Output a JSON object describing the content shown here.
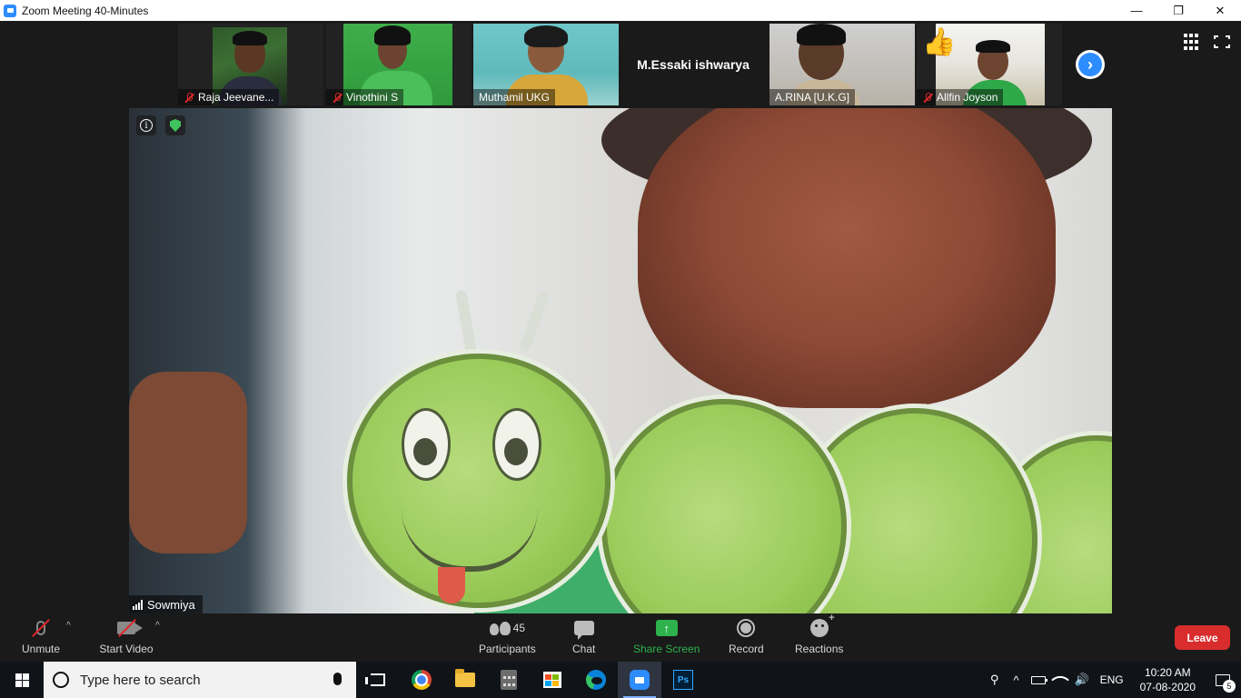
{
  "window": {
    "title": "Zoom Meeting 40-Minutes",
    "controls": [
      "—",
      "❐",
      "✕"
    ]
  },
  "participants_strip": [
    {
      "name": "Raja Jeevane...",
      "muted": true
    },
    {
      "name": "Vinothini S",
      "muted": true
    },
    {
      "name": "Muthamil UKG",
      "muted": false
    },
    {
      "name": "M.Essaki ishwarya",
      "muted": false,
      "video_off": true
    },
    {
      "name": "A.RINA  [U.K.G]",
      "muted": false
    },
    {
      "name": "Allfin Joyson",
      "muted": true,
      "reaction": "👍"
    }
  ],
  "next_page_icon": "chevron-right-icon",
  "main_video": {
    "speaker_name": "Sowmiya"
  },
  "toolbar": {
    "unmute_label": "Unmute",
    "start_video_label": "Start Video",
    "participants_label": "Participants",
    "participants_count": "45",
    "chat_label": "Chat",
    "share_screen_label": "Share Screen",
    "record_label": "Record",
    "reactions_label": "Reactions",
    "leave_label": "Leave",
    "share_color": "#2eb34c",
    "leave_color": "#d92d2d"
  },
  "taskbar": {
    "search_placeholder": "Type here to search",
    "photoshop_label": "Ps",
    "language": "ENG",
    "time": "10:20 AM",
    "date": "07-08-2020",
    "notification_count": "5"
  }
}
